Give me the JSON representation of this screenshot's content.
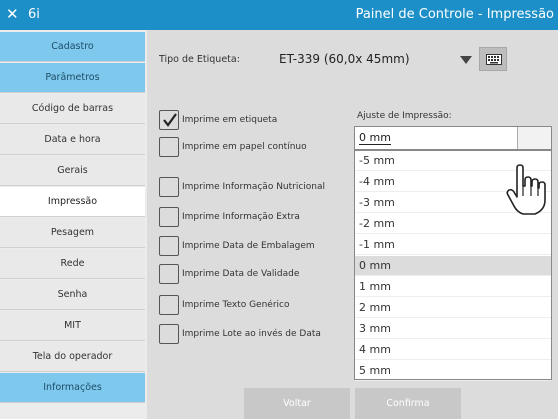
{
  "titlebar": {
    "close_glyph": "✕",
    "app_name": "6i",
    "title": "Painel de Controle - Impressão"
  },
  "sidebar": {
    "items": [
      {
        "label": "Cadastro",
        "state": "header"
      },
      {
        "label": "Parâmetros",
        "state": "header"
      },
      {
        "label": "Código de barras",
        "state": "normal"
      },
      {
        "label": "Data e hora",
        "state": "normal"
      },
      {
        "label": "Gerais",
        "state": "normal"
      },
      {
        "label": "Impressão",
        "state": "active"
      },
      {
        "label": "Pesagem",
        "state": "normal"
      },
      {
        "label": "Rede",
        "state": "normal"
      },
      {
        "label": "Senha",
        "state": "normal"
      },
      {
        "label": "MIT",
        "state": "normal"
      },
      {
        "label": "Tela do operador",
        "state": "normal"
      },
      {
        "label": "Informações",
        "state": "header"
      }
    ]
  },
  "label_type": {
    "label": "Tipo de Etiqueta:",
    "value": "ET-339 (60,0x  45mm)",
    "keyboard_icon": "keyboard-icon"
  },
  "options": [
    {
      "label": "Imprime em etiqueta",
      "checked": true
    },
    {
      "label": "Imprime em papel contínuo",
      "checked": false
    },
    {
      "label": "Imprime Informação Nutricional",
      "checked": false
    },
    {
      "label": "Imprime Informação Extra",
      "checked": false
    },
    {
      "label": "Imprime Data de Embalagem",
      "checked": false
    },
    {
      "label": "Imprime Data de Validade",
      "checked": false
    },
    {
      "label": "Imprime Texto Genérico",
      "checked": false
    },
    {
      "label": "Imprime Lote ao invés de Data",
      "checked": false
    }
  ],
  "adjust": {
    "label": "Ajuste de Impressão:",
    "value": "0 mm",
    "dropdown_items": [
      "-5 mm",
      "-4 mm",
      "-3 mm",
      "-2 mm",
      "-1 mm",
      "0 mm",
      "1 mm",
      "2 mm",
      "3 mm",
      "4 mm",
      "5 mm"
    ],
    "selected_item": "0 mm"
  },
  "buttons": {
    "back": "Voltar",
    "confirm": "Confirma"
  },
  "colors": {
    "titlebar": "#1d8fc8",
    "sidebar_header": "#7ec8ee",
    "sidebar_active": "#ffffff",
    "button_disabled": "#c8c8c8"
  }
}
